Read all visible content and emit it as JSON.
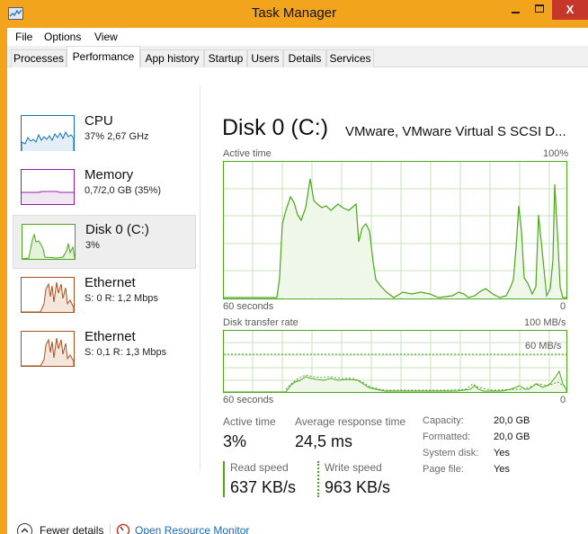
{
  "window": {
    "title": "Task Manager",
    "close_glyph": "X",
    "icon": "task-manager-icon"
  },
  "menu": [
    "File",
    "Options",
    "View"
  ],
  "tabs": [
    {
      "label": "Processes",
      "active": false
    },
    {
      "label": "Performance",
      "active": true
    },
    {
      "label": "App history",
      "active": false
    },
    {
      "label": "Startup",
      "active": false
    },
    {
      "label": "Users",
      "active": false
    },
    {
      "label": "Details",
      "active": false
    },
    {
      "label": "Services",
      "active": false
    }
  ],
  "sidebar": {
    "items": [
      {
        "name": "CPU",
        "detail": "37% 2,67 GHz",
        "color": "#1170b5",
        "selected": false
      },
      {
        "name": "Memory",
        "detail": "0,7/2,0 GB (35%)",
        "color": "#8b1e9f",
        "selected": false
      },
      {
        "name": "Disk 0 (C:)",
        "detail": "3%",
        "color": "#4ca61b",
        "selected": true
      },
      {
        "name": "Ethernet",
        "detail": "S: 0 R: 1,2 Mbps",
        "color": "#a84f1f",
        "selected": false
      },
      {
        "name": "Ethernet",
        "detail": "S: 0,1 R: 1,3 Mbps",
        "color": "#a84f1f",
        "selected": false
      }
    ]
  },
  "main": {
    "title": "Disk 0 (C:)",
    "model": "VMware, VMware Virtual S SCSI D...",
    "graph1": {
      "label": "Active time",
      "max_label": "100%",
      "time_label": "60 seconds",
      "min_label": "0"
    },
    "graph2": {
      "label": "Disk transfer rate",
      "max_label": "100 MB/s",
      "mid_label": "60 MB/s",
      "time_label": "60 seconds",
      "min_label": "0"
    },
    "stats": {
      "active_time_label": "Active time",
      "active_time": "3%",
      "response_label": "Average response time",
      "response": "24,5 ms",
      "read_label": "Read speed",
      "read": "637 KB/s",
      "write_label": "Write speed",
      "write": "963 KB/s"
    },
    "properties": [
      {
        "label": "Capacity:",
        "value": "20,0 GB"
      },
      {
        "label": "Formatted:",
        "value": "20,0 GB"
      },
      {
        "label": "System disk:",
        "value": "Yes"
      },
      {
        "label": "Page file:",
        "value": "Yes"
      }
    ]
  },
  "footer": {
    "fewer_details": "Fewer details",
    "resource_monitor": "Open Resource Monitor"
  },
  "colors": {
    "frame": "#f2a51c",
    "disk_line": "#4ca61b",
    "disk_fill": "#eef7e8",
    "grid": "#c5e3b5",
    "link": "#1c67b3"
  }
}
